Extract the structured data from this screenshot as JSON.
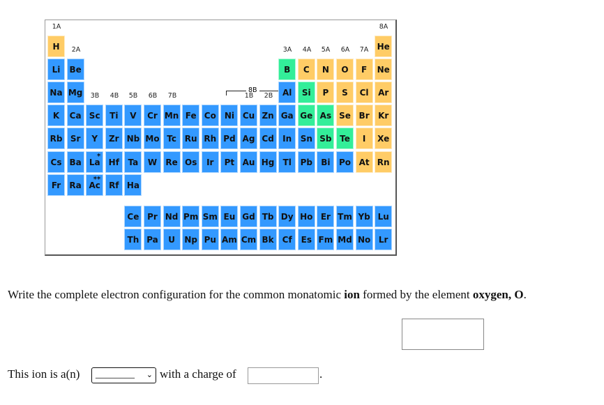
{
  "colors": {
    "metal": "#3399ff",
    "nonmetal": "#ffcc66",
    "metalloid": "#33ee99"
  },
  "periodic_table": {
    "rows": [
      [
        "H",
        null,
        null,
        null,
        null,
        null,
        null,
        null,
        null,
        null,
        null,
        null,
        null,
        null,
        null,
        null,
        null,
        "He"
      ],
      [
        "Li",
        "Be",
        null,
        null,
        null,
        null,
        null,
        null,
        null,
        null,
        null,
        null,
        "B",
        "C",
        "N",
        "O",
        "F",
        "Ne"
      ],
      [
        "Na",
        "Mg",
        null,
        null,
        null,
        null,
        null,
        null,
        null,
        null,
        null,
        null,
        "Al",
        "Si",
        "P",
        "S",
        "Cl",
        "Ar"
      ],
      [
        "K",
        "Ca",
        "Sc",
        "Ti",
        "V",
        "Cr",
        "Mn",
        "Fe",
        "Co",
        "Ni",
        "Cu",
        "Zn",
        "Ga",
        "Ge",
        "As",
        "Se",
        "Br",
        "Kr"
      ],
      [
        "Rb",
        "Sr",
        "Y",
        "Zr",
        "Nb",
        "Mo",
        "Tc",
        "Ru",
        "Rh",
        "Pd",
        "Ag",
        "Cd",
        "In",
        "Sn",
        "Sb",
        "Te",
        "I",
        "Xe"
      ],
      [
        "Cs",
        "Ba",
        "La",
        "Hf",
        "Ta",
        "W",
        "Re",
        "Os",
        "Ir",
        "Pt",
        "Au",
        "Hg",
        "Tl",
        "Pb",
        "Bi",
        "Po",
        "At",
        "Rn"
      ],
      [
        "Fr",
        "Ra",
        "Ac",
        "Rf",
        "Ha"
      ]
    ],
    "f_rows": [
      [
        "Ce",
        "Pr",
        "Nd",
        "Pm",
        "Sm",
        "Eu",
        "Gd",
        "Tb",
        "Dy",
        "Ho",
        "Er",
        "Tm",
        "Yb",
        "Lu"
      ],
      [
        "Th",
        "Pa",
        "U",
        "Np",
        "Pu",
        "Am",
        "Cm",
        "Bk",
        "Cf",
        "Es",
        "Fm",
        "Md",
        "No",
        "Lr"
      ]
    ],
    "nonmetals": [
      "H",
      "He",
      "C",
      "N",
      "O",
      "F",
      "Ne",
      "P",
      "S",
      "Cl",
      "Ar",
      "Se",
      "Br",
      "Kr",
      "I",
      "Xe",
      "At",
      "Rn"
    ],
    "metalloids": [
      "B",
      "Si",
      "Ge",
      "As",
      "Sb",
      "Te"
    ],
    "marks": {
      "La": "*",
      "Ac": "**"
    },
    "group_labels": {
      "g1": "1A",
      "g2": "2A",
      "g3b": "3B",
      "g4b": "4B",
      "g5b": "5B",
      "g6b": "6B",
      "g7b": "7B",
      "g8b": "8B",
      "g1b": "1B",
      "g2b": "2B",
      "g3a": "3A",
      "g4a": "4A",
      "g5a": "5A",
      "g6a": "6A",
      "g7a": "7A",
      "g8a": "8A"
    }
  },
  "question": {
    "pre": "Write the complete electron configuration for the common monatomic ",
    "b1": "ion",
    "mid": " formed by the element ",
    "b2": "oxygen, O",
    "end": "."
  },
  "line2": {
    "pre": "This ion is a(n)",
    "select_value": "________",
    "mid": "with a charge of",
    "end": "."
  }
}
